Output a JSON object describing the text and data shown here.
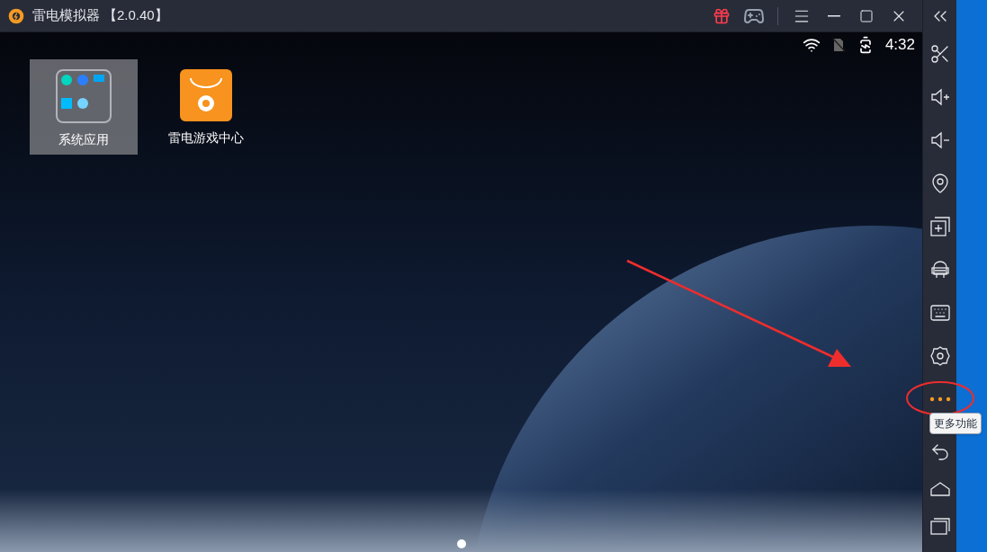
{
  "window": {
    "title": "雷电模拟器",
    "version": "【2.0.40】"
  },
  "status_bar": {
    "time": "4:32"
  },
  "desktop_icons": [
    {
      "label": "系统应用",
      "kind": "folder",
      "selected": true
    },
    {
      "label": "雷电游戏中心",
      "kind": "app",
      "selected": false
    }
  ],
  "side_toolbar": [
    {
      "kind": "collapse"
    },
    {
      "kind": "screenshot"
    },
    {
      "kind": "volume-up"
    },
    {
      "kind": "volume-down"
    },
    {
      "kind": "location"
    },
    {
      "kind": "multi-instance"
    },
    {
      "kind": "apk"
    },
    {
      "kind": "keyboard"
    },
    {
      "kind": "settings"
    },
    {
      "kind": "more",
      "highlighted": true,
      "tooltip": "更多功能"
    },
    {
      "kind": "back"
    },
    {
      "kind": "home"
    },
    {
      "kind": "recents"
    }
  ],
  "page_indicator": [
    {
      "selected": true
    }
  ]
}
